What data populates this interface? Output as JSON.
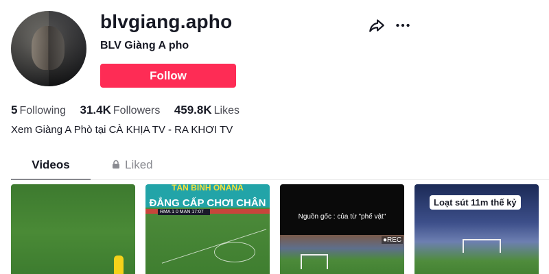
{
  "profile": {
    "username": "blvgiang.apho",
    "nickname": "BLV Giàng A pho",
    "follow_label": "Follow",
    "bio": "Xem Giàng A Phò tại CÀ KHỊA TV - RA KHƠI TV"
  },
  "stats": {
    "following_count": "5",
    "following_label": "Following",
    "followers_count": "31.4K",
    "followers_label": "Followers",
    "likes_count": "459.8K",
    "likes_label": "Likes"
  },
  "tabs": [
    {
      "label": "Videos"
    },
    {
      "label": "Liked"
    }
  ],
  "videos": [
    {},
    {
      "header_top": "TÂN BINH ONANA",
      "header_title": "ĐẲNG CẤP CHƠI CHÂN",
      "scoreboard": "RMA 1 0 MAN 17:07"
    },
    {
      "caption": "Nguồn gốc : của  từ \"phế vật\"",
      "rec": "●REC"
    },
    {
      "caption": "Loạt sút 11m thế kỷ"
    }
  ],
  "icons": {
    "share": "share-icon",
    "more": "more-icon",
    "lock": "lock-icon"
  },
  "colors": {
    "accent": "#fe2c55",
    "text": "#161823",
    "muted": "#8a8b91"
  }
}
